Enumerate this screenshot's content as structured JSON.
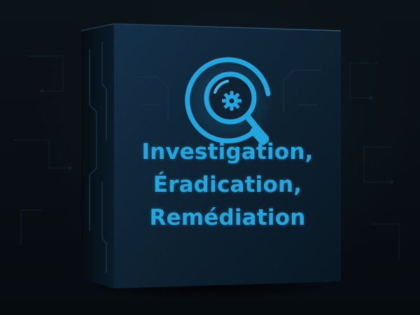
{
  "cover": {
    "title_lines": [
      "Investigation,",
      "Éradication,",
      "Remédiation"
    ]
  },
  "logo": {
    "icon": "magnifier-gear-icon"
  },
  "colors": {
    "background": "#070c11",
    "box_front": "#0f2231",
    "box_side": "#081521",
    "accent": "#22a6e0"
  }
}
